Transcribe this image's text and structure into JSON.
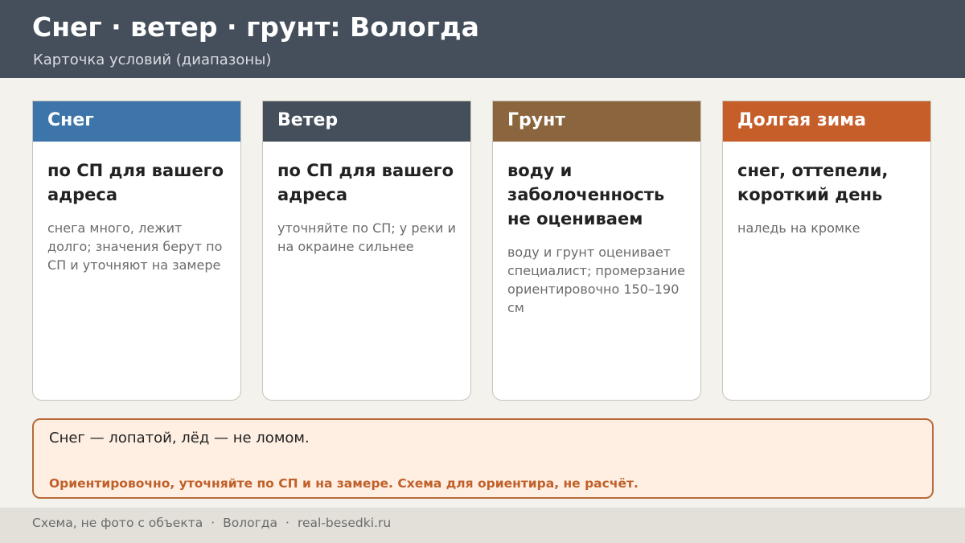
{
  "header": {
    "title": "Снег · ветер · грунт: Вологда",
    "subtitle": "Карточка условий (диапазоны)"
  },
  "cards": [
    {
      "label": "Снег",
      "color": "#3d75aa",
      "main": "по СП для вашего адреса",
      "note": "снега много, лежит долго; значения берут по СП и уточняют на замере"
    },
    {
      "label": "Ветер",
      "color": "#454f5b",
      "main": "по СП для вашего адреса",
      "note": "уточняйте по СП; у реки и на окраине сильнее"
    },
    {
      "label": "Грунт",
      "color": "#8b653e",
      "main": "воду и заболоченность не оцениваем",
      "note": "воду и грунт оценивает специалист; промерзание ориентировочно 150–190 см"
    },
    {
      "label": "Долгая зима",
      "color": "#c65e2a",
      "main": "снег, оттепели, короткий день",
      "note": "наледь на кромке"
    }
  ],
  "callout": {
    "main": "Снег — лопатой, лёд — не ломом.",
    "note": "Ориентировочно, уточняйте по СП и на замере. Схема для ориентира, не расчёт."
  },
  "footer": {
    "part1": "Схема, не фото с объекта",
    "sep": "·",
    "part2": "Вологда",
    "part3": "real-besedki.ru"
  }
}
